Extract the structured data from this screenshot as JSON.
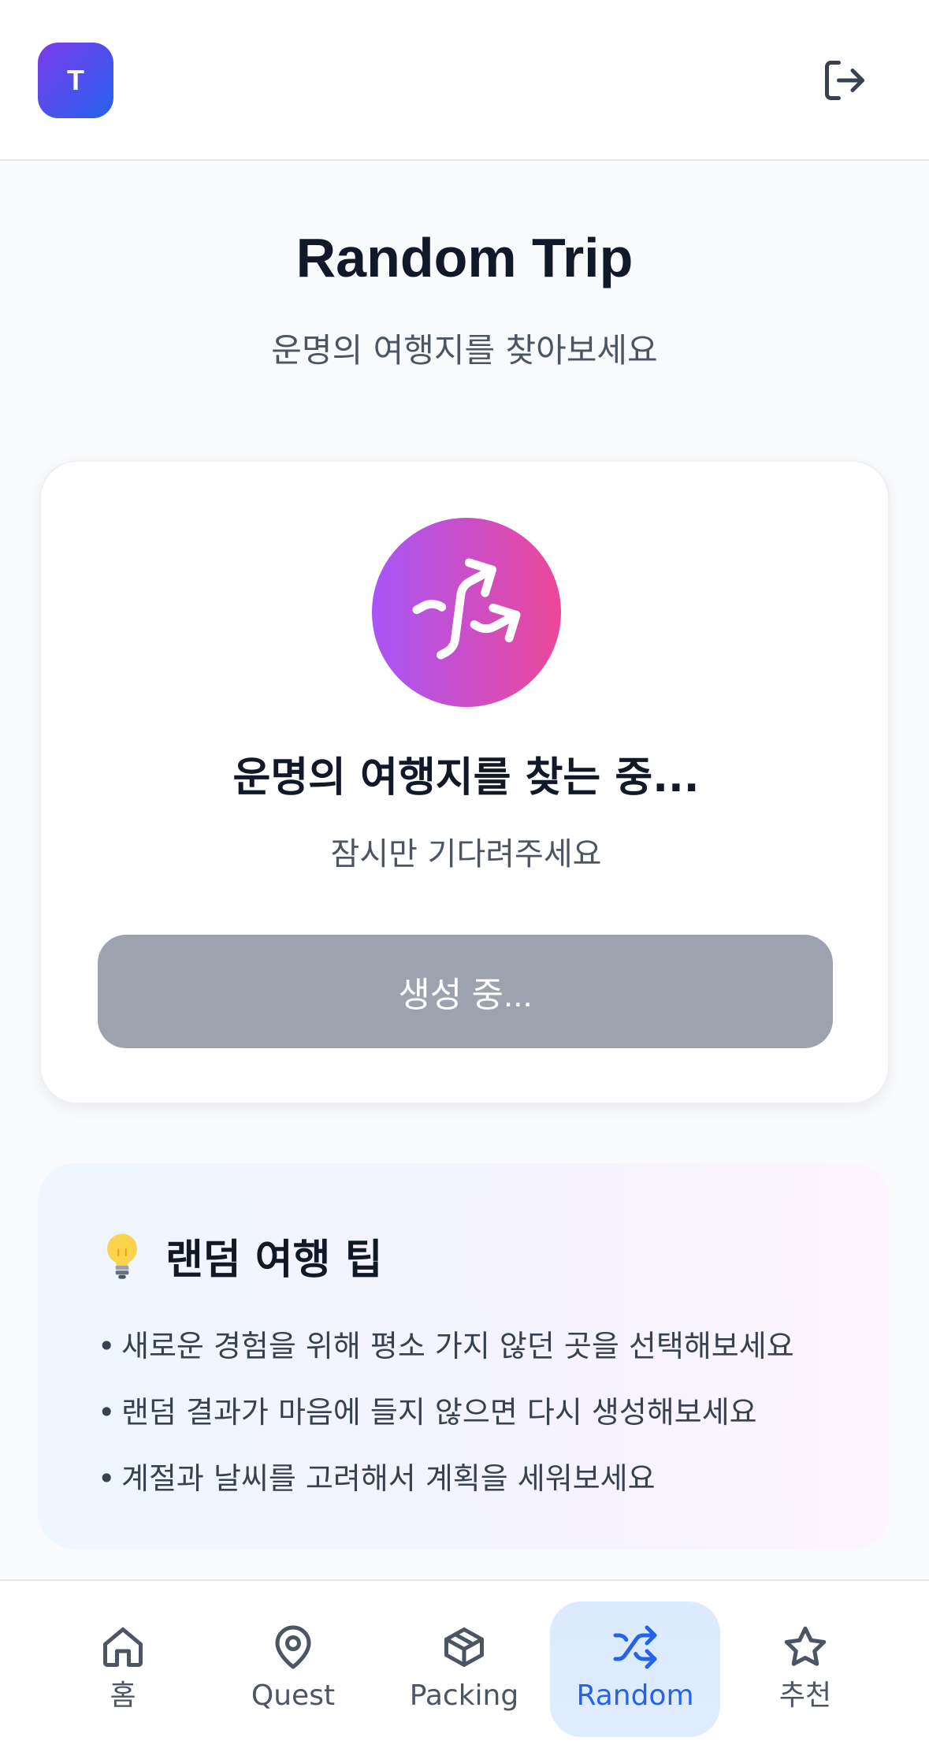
{
  "header": {
    "avatar_initial": "T",
    "logout_icon": "logout-icon"
  },
  "main": {
    "title": "Random Trip",
    "subtitle": "운명의 여행지를 찾아보세요"
  },
  "card": {
    "icon": "shuffle-icon",
    "title": "운명의 여행지를 찾는 중...",
    "subtitle": "잠시만 기다려주세요",
    "button_label": "생성 중..."
  },
  "tips": {
    "icon": "lightbulb-icon",
    "title": "랜덤 여행 팁",
    "items": [
      "새로운 경험을 위해 평소 가지 않던 곳을 선택해보세요",
      "랜덤 결과가 마음에 들지 않으면 다시 생성해보세요",
      "계절과 날씨를 고려해서 계획을 세워보세요"
    ],
    "bullet": "•"
  },
  "nav": {
    "items": [
      {
        "label": "홈",
        "icon": "home-icon"
      },
      {
        "label": "Quest",
        "icon": "map-pin-icon"
      },
      {
        "label": "Packing",
        "icon": "package-icon"
      },
      {
        "label": "Random",
        "icon": "shuffle-icon"
      },
      {
        "label": "추천",
        "icon": "star-icon"
      }
    ],
    "active": "Random"
  },
  "colors": {
    "accent": "#2563eb",
    "gradient_start": "#a855f7",
    "gradient_end": "#ec4899",
    "button_disabled": "#9ca3af"
  }
}
